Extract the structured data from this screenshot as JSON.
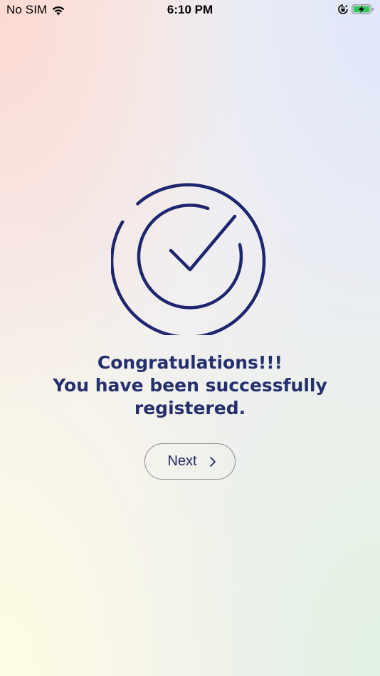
{
  "status_bar": {
    "carrier": "No SIM",
    "time": "6:10 PM",
    "icons": [
      "wifi-icon",
      "rotation-lock-icon",
      "battery-charging-icon"
    ],
    "battery_color": "#34c759"
  },
  "success": {
    "icon": "checkmark-circle-icon",
    "icon_color": "#1e2670",
    "lines": [
      "Congratulations!!!",
      "You have been successfully",
      "registered."
    ],
    "text_color": "#24306e"
  },
  "next_button": {
    "label": "Next",
    "icon": "chevron-right-icon"
  }
}
